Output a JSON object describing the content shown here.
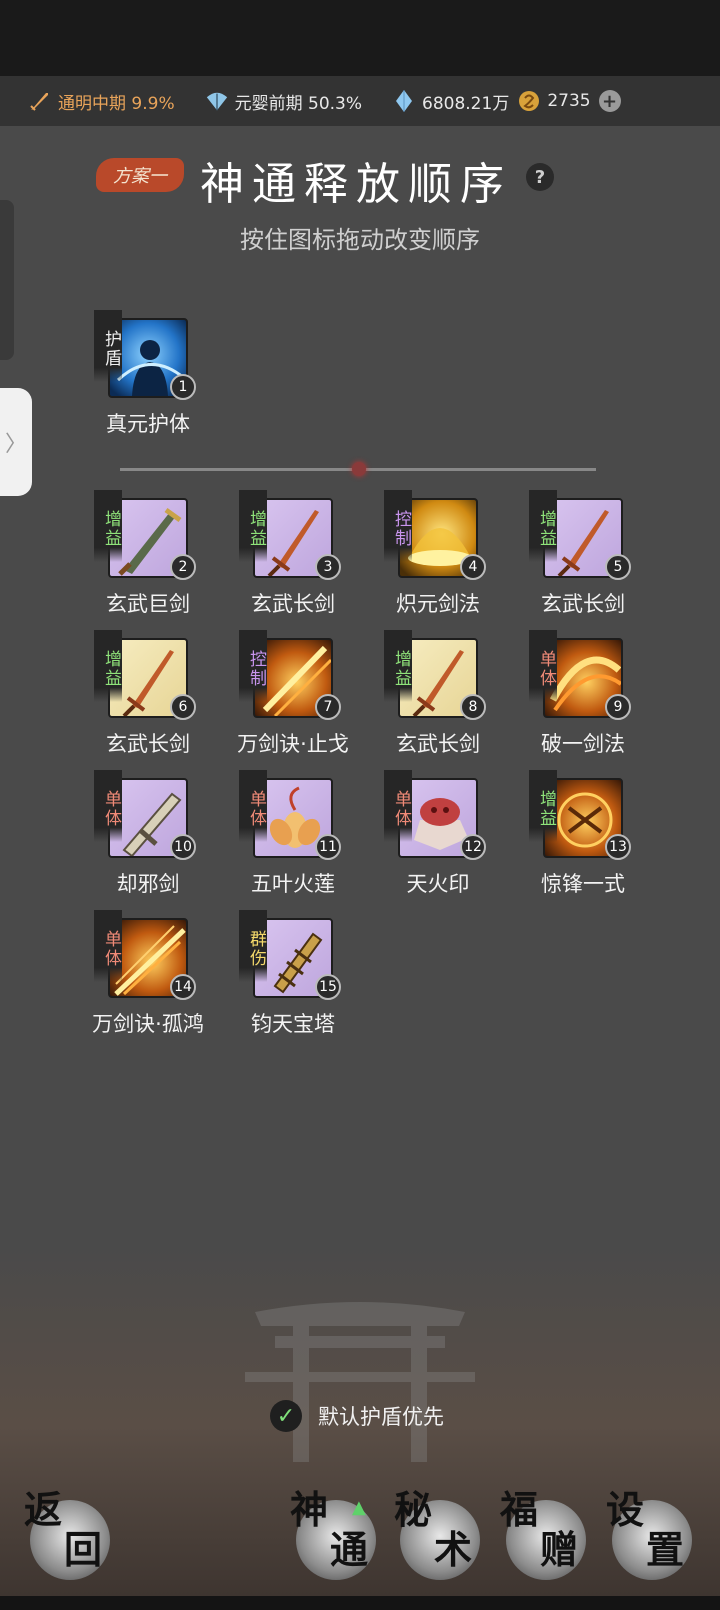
{
  "status_bar": {
    "cultivation_1": "通明中期 9.9%",
    "cultivation_2": "元婴前期 50.3%",
    "spirit_stone": "6808.21万",
    "coins": "2735",
    "plus": "+"
  },
  "header": {
    "plan_badge": "方案一",
    "title": "神通释放顺序",
    "help": "?",
    "subtitle": "按住图标拖动改变顺序"
  },
  "shield_skill": {
    "tag": "护盾",
    "name": "真元护体",
    "order": "1"
  },
  "skills": [
    {
      "tag": "增益",
      "name": "玄武巨剑",
      "order": "2"
    },
    {
      "tag": "增益",
      "name": "玄武长剑",
      "order": "3"
    },
    {
      "tag": "控制",
      "name": "炽元剑法",
      "order": "4"
    },
    {
      "tag": "增益",
      "name": "玄武长剑",
      "order": "5"
    },
    {
      "tag": "增益",
      "name": "玄武长剑",
      "order": "6"
    },
    {
      "tag": "控制",
      "name": "万剑诀·止戈",
      "order": "7"
    },
    {
      "tag": "增益",
      "name": "玄武长剑",
      "order": "8"
    },
    {
      "tag": "单体",
      "name": "破一剑法",
      "order": "9"
    },
    {
      "tag": "单体",
      "name": "却邪剑",
      "order": "10"
    },
    {
      "tag": "单体",
      "name": "五叶火莲",
      "order": "11"
    },
    {
      "tag": "单体",
      "name": "天火印",
      "order": "12"
    },
    {
      "tag": "增益",
      "name": "惊锋一式",
      "order": "13"
    },
    {
      "tag": "单体",
      "name": "万剑诀·孤鸿",
      "order": "14"
    },
    {
      "tag": "群伤",
      "name": "钧天宝塔",
      "order": "15"
    }
  ],
  "default_shield": {
    "label": "默认护盾优先",
    "checked": true
  },
  "bottom_nav": {
    "back": [
      "返",
      "回"
    ],
    "shentong": [
      "神",
      "通"
    ],
    "mishu": [
      "秘",
      "术"
    ],
    "fuzeng": [
      "福",
      "赠"
    ],
    "settings": [
      "设",
      "置"
    ]
  }
}
